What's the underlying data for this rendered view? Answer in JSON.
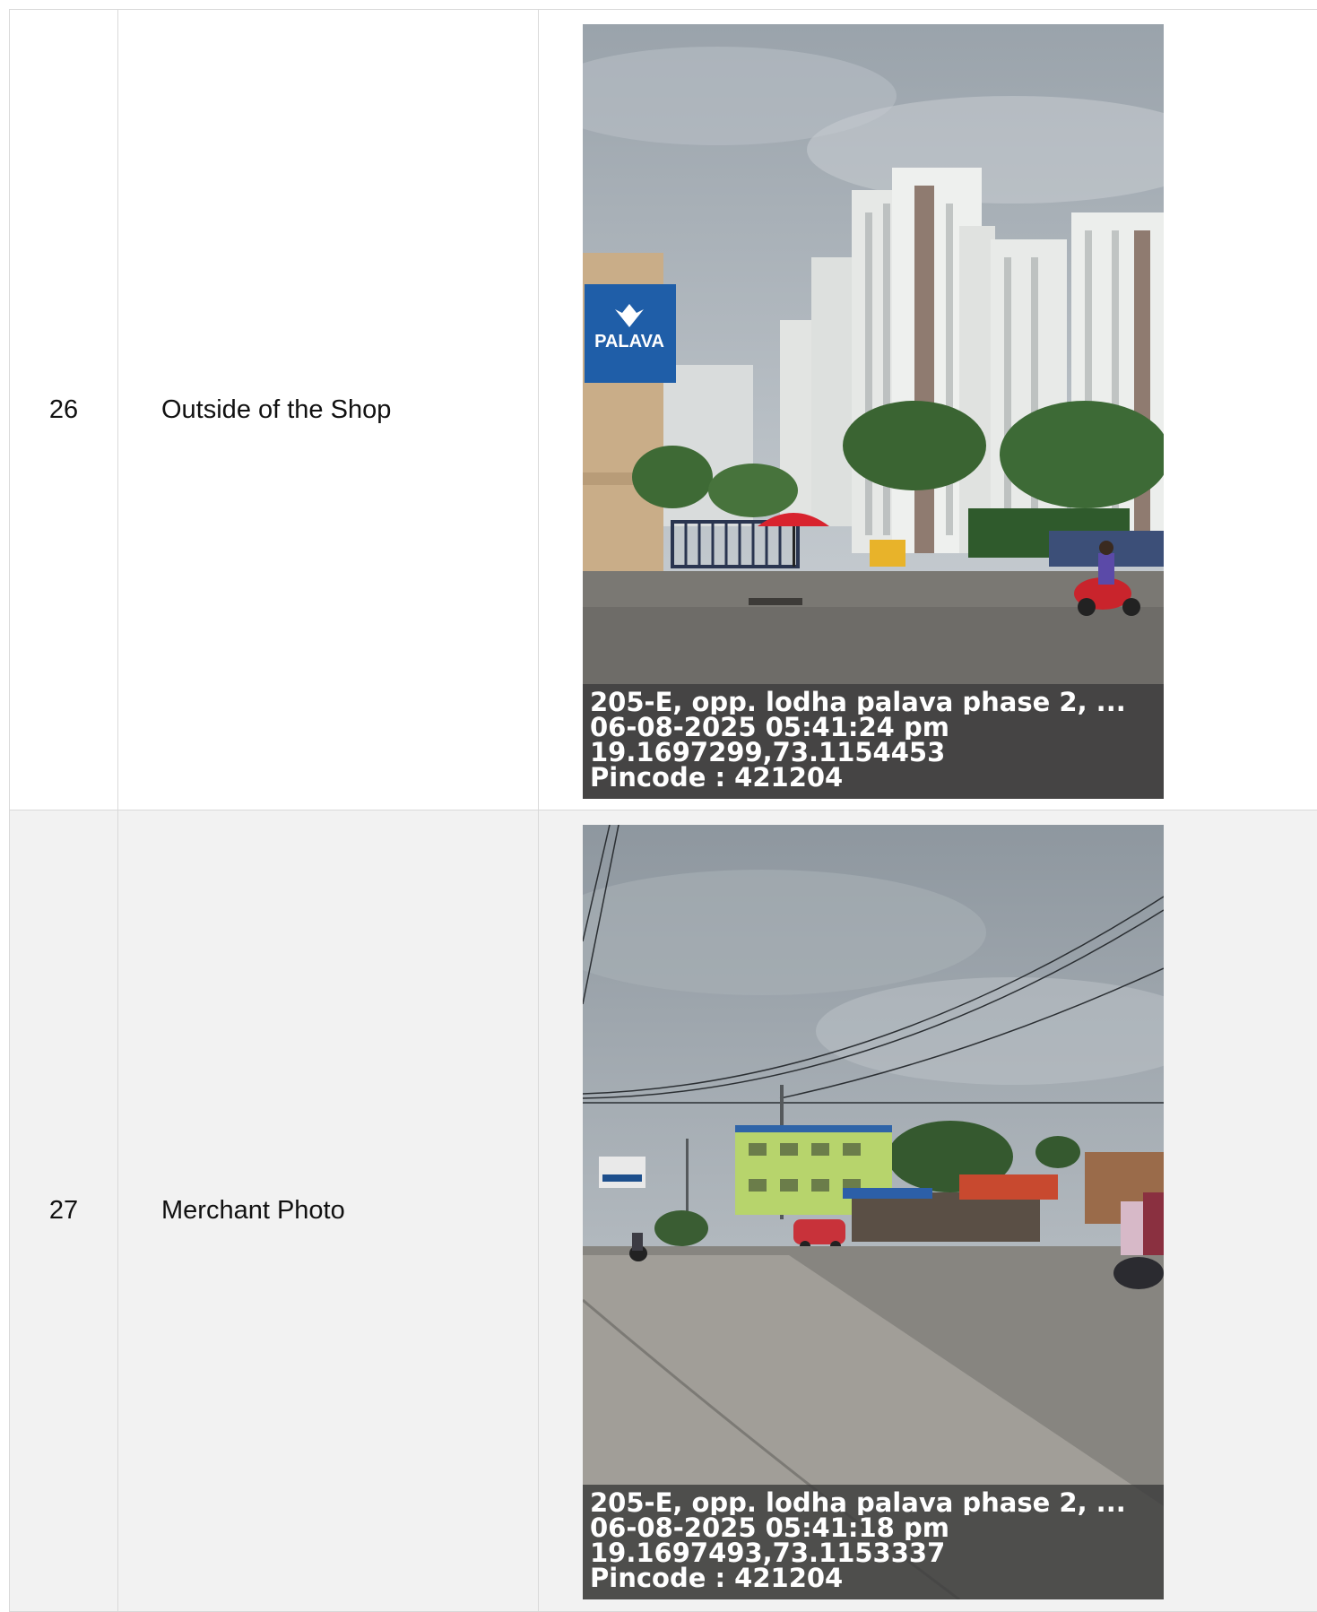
{
  "rows": [
    {
      "number": "26",
      "description": "Outside of the Shop",
      "photo": {
        "scene": "residential-towers-gate",
        "sign_text": "PALAVA",
        "overlay": [
          "205-E, opp. lodha palava phase 2, ...",
          "06-08-2025 05:41:24 pm",
          "19.1697299,73.1154453",
          "Pincode : 421204"
        ]
      }
    },
    {
      "number": "27",
      "description": "Merchant Photo",
      "photo": {
        "scene": "roadside-market",
        "overlay": [
          "205-E, opp. lodha palava phase 2, ...",
          "06-08-2025 05:41:18 pm",
          "19.1697493,73.1153337",
          "Pincode : 421204"
        ]
      }
    }
  ]
}
